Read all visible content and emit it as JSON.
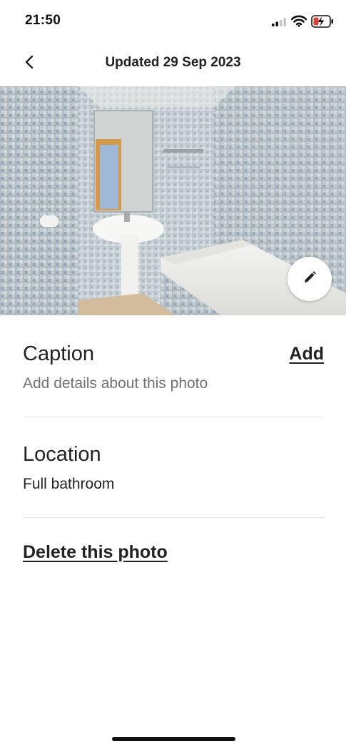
{
  "status_bar": {
    "time": "21:50",
    "icons": [
      "signal-icon",
      "wifi-icon",
      "battery-charging-icon"
    ]
  },
  "header": {
    "back_icon": "chevron-left-icon",
    "title": "Updated 29 Sep 2023"
  },
  "photo": {
    "subject": "bathroom",
    "edit_icon": "pencil-icon"
  },
  "caption": {
    "title": "Caption",
    "action_label": "Add",
    "placeholder": "Add details about this photo"
  },
  "location": {
    "title": "Location",
    "value": "Full bathroom"
  },
  "delete_label": "Delete this photo",
  "colors": {
    "text_primary": "#222222",
    "text_secondary": "#717171",
    "divider": "#e4e4e4"
  }
}
